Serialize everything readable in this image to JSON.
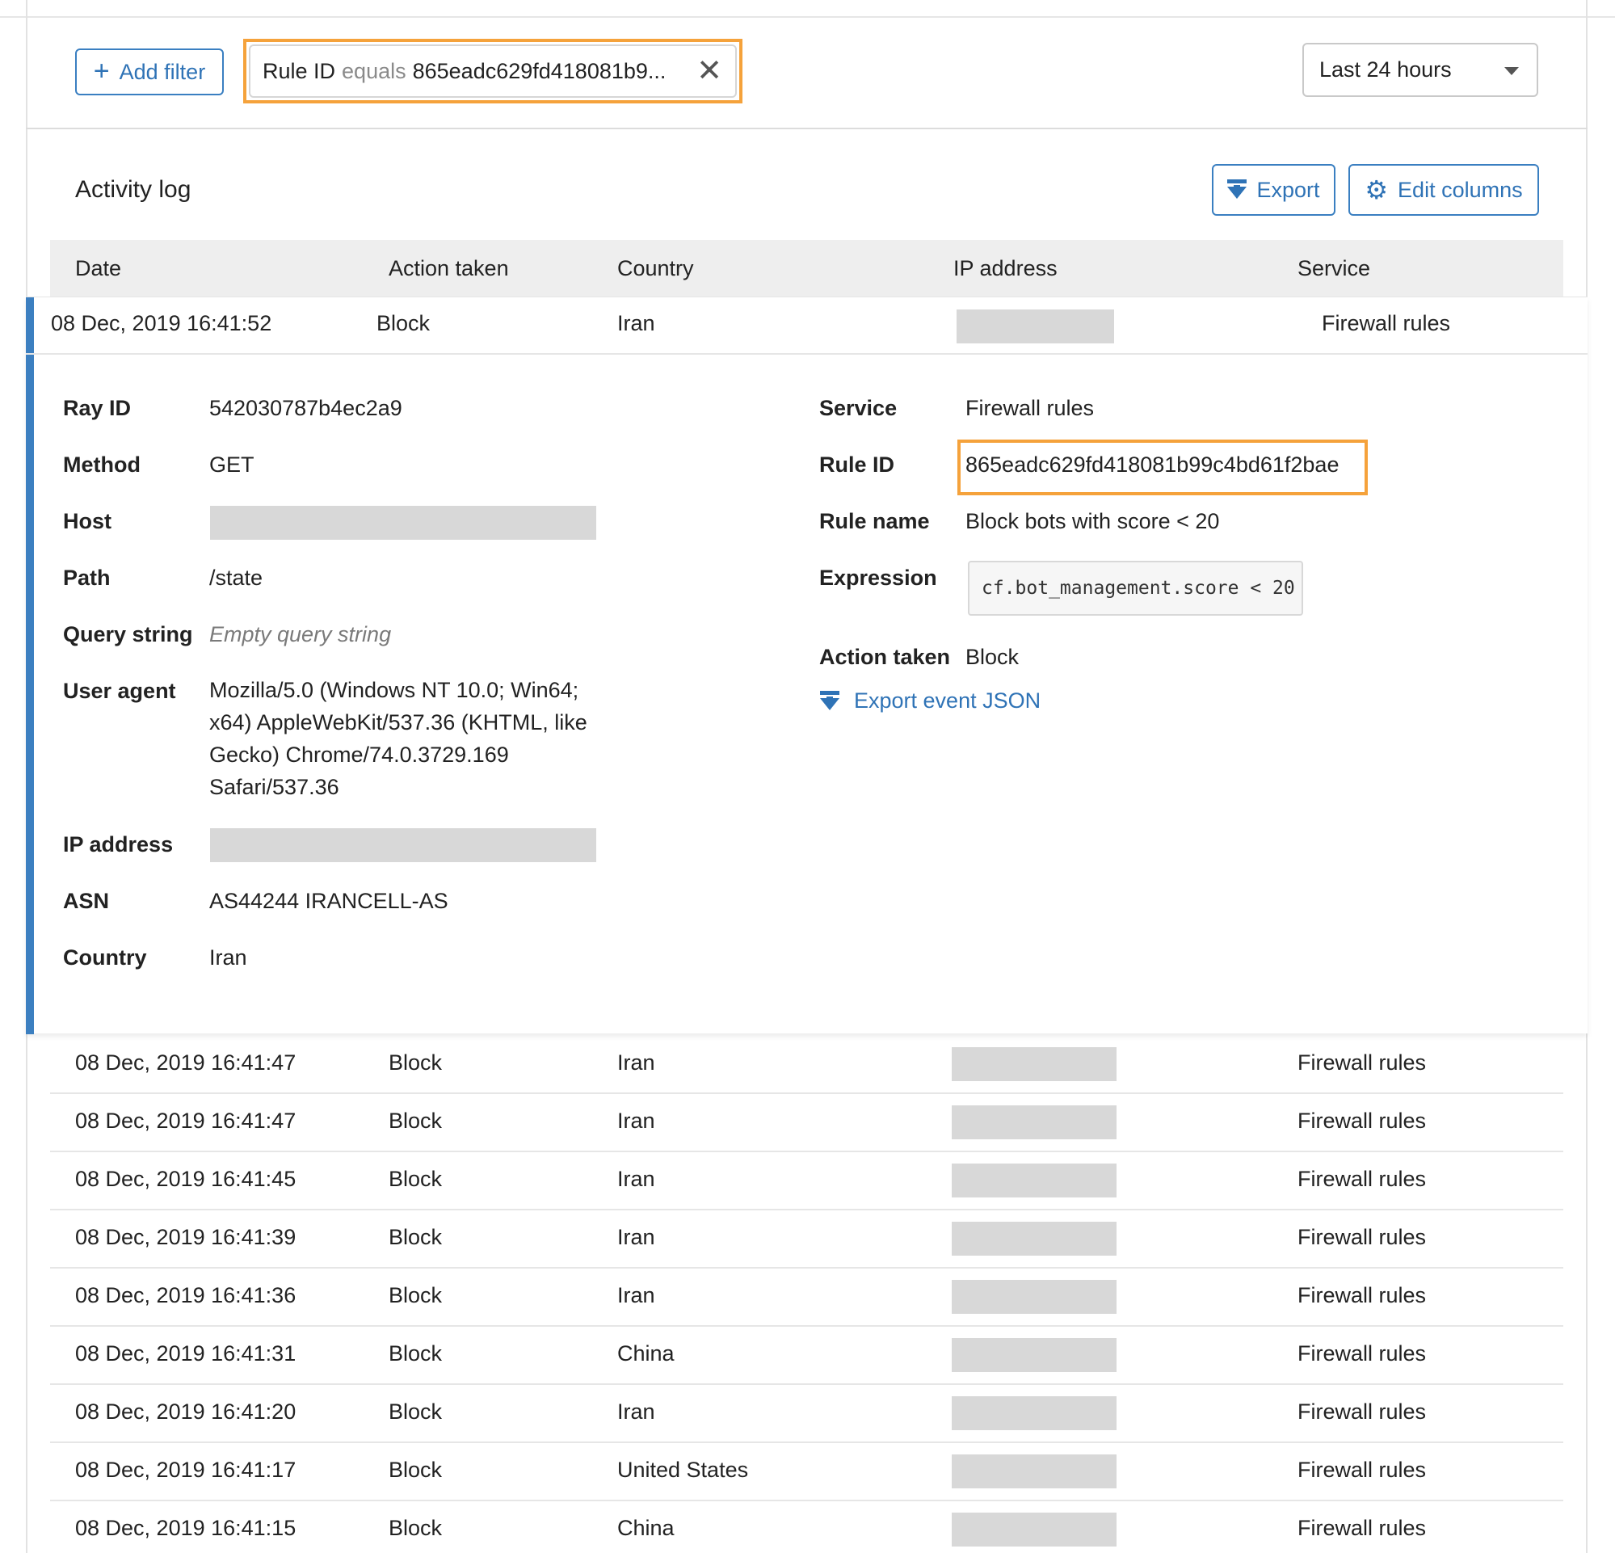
{
  "filter_bar": {
    "add_filter_label": "Add filter",
    "chip": {
      "field": "Rule ID",
      "operator": "equals",
      "value": "865eadc629fd418081b9..."
    },
    "time_range": "Last 24 hours"
  },
  "activity": {
    "title": "Activity log",
    "export_label": "Export",
    "edit_columns_label": "Edit columns"
  },
  "columns": [
    "Date",
    "Action taken",
    "Country",
    "IP address",
    "Service"
  ],
  "selected_row": {
    "date": "08 Dec, 2019 16:41:52",
    "action": "Block",
    "country": "Iran",
    "service": "Firewall rules"
  },
  "details": {
    "left": {
      "ray_id": {
        "label": "Ray ID",
        "value": "542030787b4ec2a9"
      },
      "method": {
        "label": "Method",
        "value": "GET"
      },
      "host": {
        "label": "Host"
      },
      "path": {
        "label": "Path",
        "value": "/state"
      },
      "query_string": {
        "label": "Query string",
        "value": "Empty query string"
      },
      "user_agent": {
        "label": "User agent",
        "lines": [
          "Mozilla/5.0 (Windows NT 10.0; Win64;",
          "x64) AppleWebKit/537.36 (KHTML, like",
          "Gecko) Chrome/74.0.3729.169",
          "Safari/537.36"
        ]
      },
      "ip_address": {
        "label": "IP address"
      },
      "asn": {
        "label": "ASN",
        "value": "AS44244 IRANCELL-AS"
      },
      "country": {
        "label": "Country",
        "value": "Iran"
      }
    },
    "right": {
      "service": {
        "label": "Service",
        "value": "Firewall rules"
      },
      "rule_id": {
        "label": "Rule ID",
        "value": "865eadc629fd418081b99c4bd61f2bae"
      },
      "rule_name": {
        "label": "Rule name",
        "value": "Block bots with score < 20"
      },
      "expression": {
        "label": "Expression",
        "value": "cf.bot_management.score < 20"
      },
      "action_taken": {
        "label": "Action taken",
        "value": "Block"
      },
      "export_json_label": "Export event JSON"
    }
  },
  "rows": [
    {
      "date": "08 Dec, 2019 16:41:47",
      "action": "Block",
      "country": "Iran",
      "service": "Firewall rules"
    },
    {
      "date": "08 Dec, 2019 16:41:47",
      "action": "Block",
      "country": "Iran",
      "service": "Firewall rules"
    },
    {
      "date": "08 Dec, 2019 16:41:45",
      "action": "Block",
      "country": "Iran",
      "service": "Firewall rules"
    },
    {
      "date": "08 Dec, 2019 16:41:39",
      "action": "Block",
      "country": "Iran",
      "service": "Firewall rules"
    },
    {
      "date": "08 Dec, 2019 16:41:36",
      "action": "Block",
      "country": "Iran",
      "service": "Firewall rules"
    },
    {
      "date": "08 Dec, 2019 16:41:31",
      "action": "Block",
      "country": "China",
      "service": "Firewall rules"
    },
    {
      "date": "08 Dec, 2019 16:41:20",
      "action": "Block",
      "country": "Iran",
      "service": "Firewall rules"
    },
    {
      "date": "08 Dec, 2019 16:41:17",
      "action": "Block",
      "country": "United States",
      "service": "Firewall rules"
    },
    {
      "date": "08 Dec, 2019 16:41:15",
      "action": "Block",
      "country": "China",
      "service": "Firewall rules"
    }
  ],
  "colors": {
    "accent": "#2f73b6",
    "highlight": "#f5a23b",
    "redacted": "#d8d8d8"
  }
}
